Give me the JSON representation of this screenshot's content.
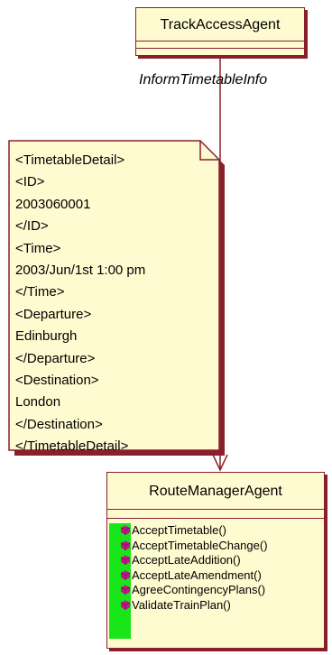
{
  "track_agent": {
    "name": "TrackAccessAgent"
  },
  "association": {
    "label": "InformTimetableInfo"
  },
  "note": {
    "lines": [
      "<TimetableDetail>",
      "<ID>",
      "2003060001",
      "</ID>",
      "<Time>",
      "2003/Jun/1st 1:00 pm",
      "</Time>",
      "<Departure>",
      "Edinburgh",
      "</Departure>",
      "<Destination>",
      "London",
      "</Destination>",
      "</TimetableDetail>"
    ]
  },
  "route_agent": {
    "name": "RouteManagerAgent",
    "operations": [
      "AcceptTimetable()",
      "AcceptTimetableChange()",
      "AcceptLateAddition()",
      "AcceptLateAmendment()",
      "AgreeContingencyPlans()",
      "ValidateTrainPlan()"
    ],
    "operation_icon": "method-icon"
  },
  "colors": {
    "box_fill": "#fffbd0",
    "border": "#8a1f2c",
    "operation_bar": "#19e619",
    "method_icon": "#c2188a"
  }
}
